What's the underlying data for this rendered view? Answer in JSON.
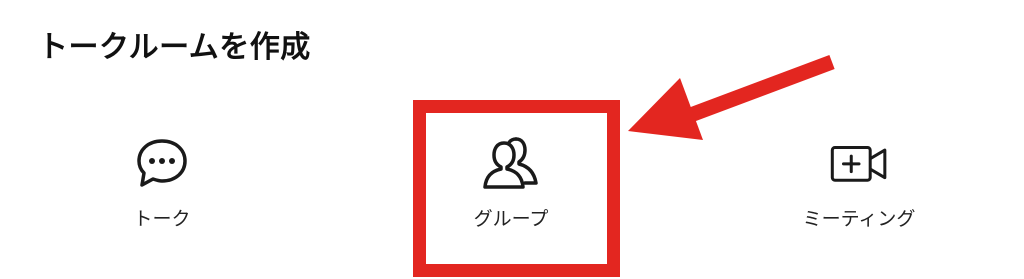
{
  "page": {
    "title": "トークルームを作成"
  },
  "options": [
    {
      "label": "トーク",
      "icon": "chat-bubble-icon"
    },
    {
      "label": "グループ",
      "icon": "group-people-icon"
    },
    {
      "label": "ミーティング",
      "icon": "video-camera-plus-icon"
    }
  ],
  "annotation": {
    "highlight_color": "#e32620",
    "highlight_target": "グループ",
    "arrow_color": "#e32620"
  }
}
